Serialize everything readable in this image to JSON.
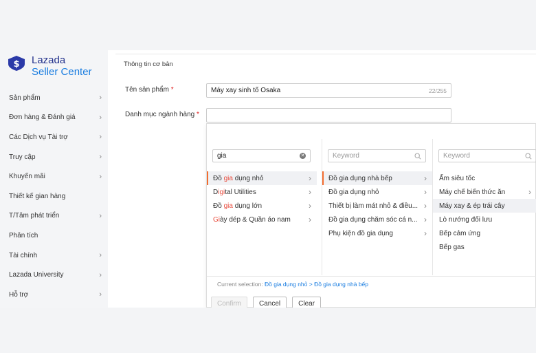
{
  "brand": {
    "name": "Lazada",
    "sub": "Seller Center",
    "colors": {
      "primary": "#23328c",
      "accent": "#1a7de0",
      "highlight": "#e84c3d",
      "selection": "#f36c2e"
    }
  },
  "sidebar": {
    "items": [
      {
        "label": "Sản phẩm",
        "chevron": true
      },
      {
        "label": "Đơn hàng & Đánh giá",
        "chevron": true
      },
      {
        "label": "Các Dịch vụ Tài trợ",
        "chevron": true
      },
      {
        "label": "Truy cập",
        "chevron": true
      },
      {
        "label": "Khuyến mãi",
        "chevron": true
      },
      {
        "label": "Thiết kế gian hàng",
        "chevron": false
      },
      {
        "label": "T/Tâm phát triển",
        "chevron": true
      },
      {
        "label": "Phân tích",
        "chevron": false
      },
      {
        "label": "Tài chính",
        "chevron": true
      },
      {
        "label": "Lazada University",
        "chevron": true
      },
      {
        "label": "Hỗ trợ",
        "chevron": true
      }
    ]
  },
  "form": {
    "section_title": "Thông tin cơ bản",
    "name_label": "Tên sản phẩm",
    "name_value": "Máy xay sinh tố Osaka",
    "name_counter": "22/255",
    "category_label": "Danh mục ngành hàng",
    "required_mark": "*"
  },
  "category_picker": {
    "col1": {
      "search_value": "gia",
      "items": [
        {
          "pre": "Đồ ",
          "hl": "gia",
          "post": " dụng nhỏ",
          "selected": true
        },
        {
          "pre": "D",
          "hl": "igi",
          "post": "tal Utilities",
          "selected": false
        },
        {
          "pre": "Đồ ",
          "hl": "gia",
          "post": " dụng lớn",
          "selected": false
        },
        {
          "pre": "",
          "hl": "Gi",
          "post": "ày dép & Quần áo nam",
          "selected": false
        }
      ]
    },
    "col2": {
      "search_placeholder": "Keyword",
      "items": [
        {
          "label": "Đồ gia dụng nhà bếp",
          "selected": true
        },
        {
          "label": "Đồ gia dụng nhỏ",
          "selected": false
        },
        {
          "label": "Thiết bị làm mát nhỏ & điều...",
          "selected": false
        },
        {
          "label": "Đồ gia dụng chăm sóc cá n...",
          "selected": false
        },
        {
          "label": "Phụ kiện đồ gia dụng",
          "selected": false
        }
      ]
    },
    "col3": {
      "search_placeholder": "Keyword",
      "items": [
        {
          "label": "Ấm siêu tốc",
          "chevron": false,
          "selected": false
        },
        {
          "label": "Máy chế biến thức ăn",
          "chevron": true,
          "selected": false
        },
        {
          "label": "Máy xay & ép trái cây",
          "chevron": false,
          "selected": true
        },
        {
          "label": "Lò nướng đối lưu",
          "chevron": false,
          "selected": false
        },
        {
          "label": "Bếp cảm ứng",
          "chevron": false,
          "selected": false
        },
        {
          "label": "Bếp gas",
          "chevron": false,
          "selected": false
        }
      ]
    },
    "current_selection_label": "Current selection:",
    "current_selection_path": "Đồ gia dụng nhỏ > Đồ gia dụng nhà bếp",
    "buttons": {
      "confirm": "Confirm",
      "cancel": "Cancel",
      "clear": "Clear"
    }
  }
}
